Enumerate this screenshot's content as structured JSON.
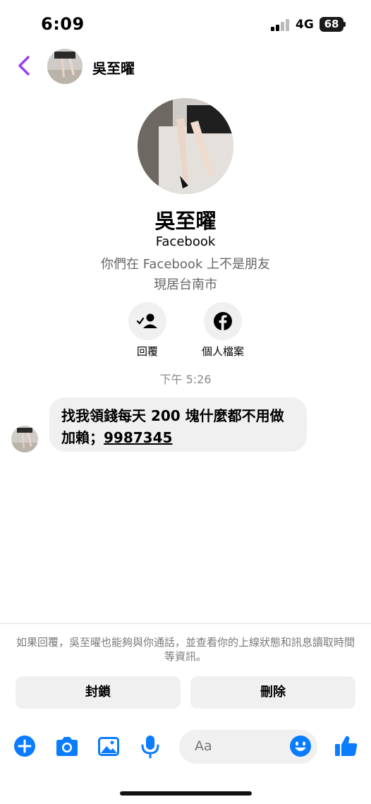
{
  "status": {
    "time": "6:09",
    "network": "4G",
    "battery": "68"
  },
  "header": {
    "name": "吳至曜",
    "back_icon": "chevron-left-icon"
  },
  "profile": {
    "name": "吳至曜",
    "source": "Facebook",
    "relationship": "你們在 Facebook 上不是朋友",
    "location": "現居台南市",
    "actions": [
      {
        "label": "回覆",
        "icon": "person-check-icon"
      },
      {
        "label": "個人檔案",
        "icon": "facebook-icon"
      }
    ]
  },
  "conversation": {
    "timestamp": "下午 5:26",
    "message": {
      "line1": "找我領錢每天 200 塊什麼都不用做",
      "line2_prefix": "加賴；",
      "link": "9987345"
    }
  },
  "footer": {
    "notice": "如果回覆，吳至曜也能夠與你通話，並查看你的上線狀態和訊息讀取時間等資訊。",
    "block_label": "封鎖",
    "delete_label": "刪除",
    "compose_placeholder": "Aa",
    "tools": [
      "plus-icon",
      "camera-icon",
      "gallery-icon",
      "microphone-icon",
      "emoji-icon",
      "like-icon"
    ]
  },
  "colors": {
    "accent": "#9b3cf0",
    "messenger_blue": "#0a7cff",
    "bubble": "#f0f0f0",
    "muted": "#666666"
  }
}
